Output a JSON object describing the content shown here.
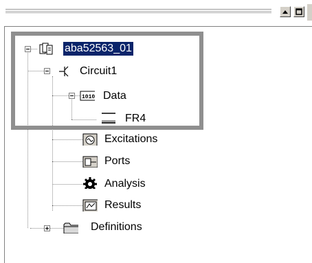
{
  "window": {
    "buttons": [
      {
        "name": "minimize-icon",
        "glyph": "▲"
      },
      {
        "name": "maximize-icon",
        "glyph": "□"
      }
    ]
  },
  "tree": {
    "root": {
      "label": "aba52563_01",
      "expanded": true,
      "selected": true,
      "icon": "project-icon"
    },
    "circuit": {
      "label": "Circuit1",
      "expanded": true,
      "icon": "circuit-icon"
    },
    "data": {
      "label": "Data",
      "expanded": true,
      "icon": "data-icon"
    },
    "fr4": {
      "label": "FR4",
      "icon": "substrate-icon"
    },
    "excitations": {
      "label": "Excitations",
      "icon": "excitation-icon"
    },
    "ports": {
      "label": "Ports",
      "icon": "ports-icon"
    },
    "analysis": {
      "label": "Analysis",
      "icon": "gear-icon"
    },
    "results": {
      "label": "Results",
      "icon": "results-icon"
    },
    "definitions": {
      "label": "Definitions",
      "expanded": false,
      "icon": "folder-icon"
    }
  }
}
